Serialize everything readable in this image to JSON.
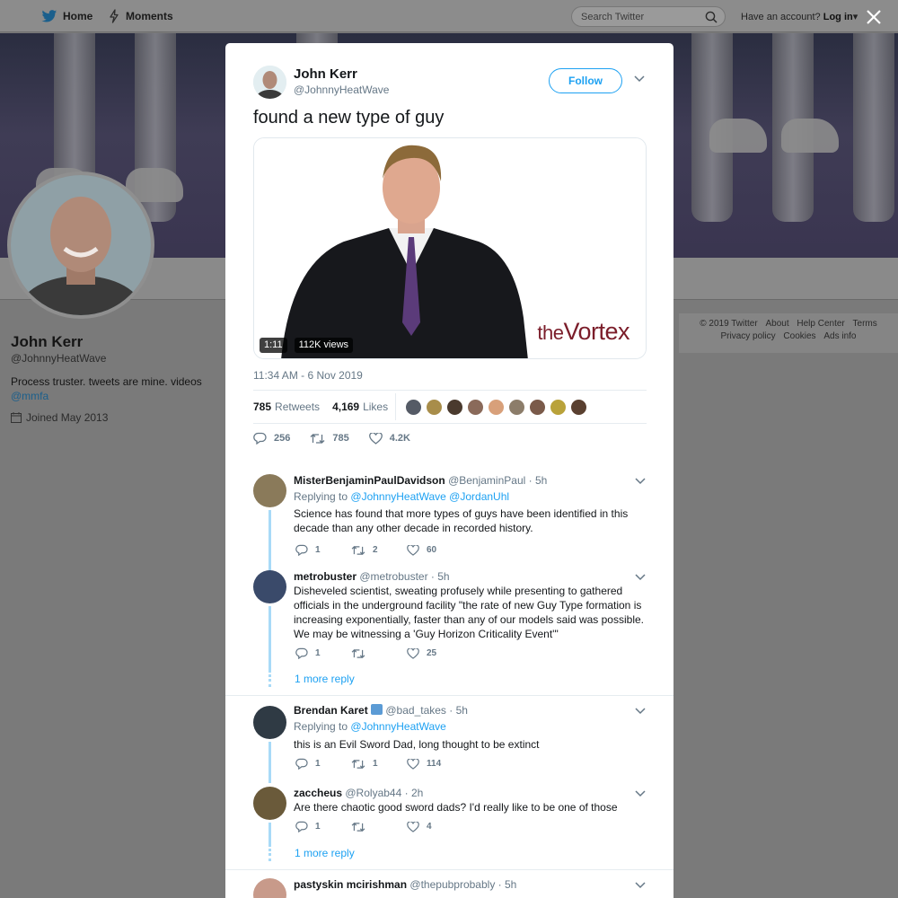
{
  "nav": {
    "home_label": "Home",
    "moments_label": "Moments",
    "search_placeholder": "Search Twitter",
    "have_account": "Have an account?",
    "login_label": "Log in"
  },
  "profile": {
    "name": "John Kerr",
    "handle": "@JohnnyHeatWave",
    "bio": "Process truster. tweets are mine. videos",
    "bio_link": "@mmfa",
    "joined": "Joined May 2013"
  },
  "footer": {
    "items": [
      "© 2019 Twitter",
      "About",
      "Help Center",
      "Terms",
      "Privacy policy",
      "Cookies",
      "Ads info"
    ]
  },
  "tweet": {
    "author_name": "John Kerr",
    "author_handle": "@JohnnyHeatWave",
    "follow_label": "Follow",
    "text": "found a new type of guy",
    "video_duration": "1:11",
    "video_views": "112K views",
    "video_brand_prefix": "the",
    "video_brand_name": "Vortex",
    "timestamp": "11:34 AM - 6 Nov 2019",
    "retweets_count": "785",
    "retweets_label": "Retweets",
    "likes_count": "4,169",
    "likes_label": "Likes",
    "action_replies": "256",
    "action_retweets": "785",
    "action_likes": "4.2K",
    "liker_colors": [
      "#555b66",
      "#a88d4a",
      "#4a3a2e",
      "#8a6a5a",
      "#d8a07a",
      "#8c7d6a",
      "#7a5a4a",
      "#b9a23a",
      "#5a4030"
    ]
  },
  "replies": [
    {
      "name": "MisterBenjaminPaulDavidson",
      "handle": "@BenjaminPaul",
      "time": "· 5h",
      "replying_prefix": "Replying to",
      "replying_to": "@JohnnyHeatWave @JordanUhl",
      "text": "Science has found that more types of guys have been identified in this decade than any other decade in recorded history.",
      "replies": "1",
      "retweets": "2",
      "likes": "60"
    },
    {
      "name": "metrobuster",
      "handle": "@metrobuster",
      "time": "· 5h",
      "text": "Disheveled scientist, sweating profusely while presenting to gathered officials in the underground facility \"the rate of new Guy Type formation is increasing exponentially, faster than any of our models said was possible. We may be witnessing a 'Guy Horizon Criticality Event'\"",
      "replies": "1",
      "retweets": "",
      "likes": "25",
      "more_reply": "1 more reply"
    },
    {
      "name": "Brendan Karet",
      "handle": "@bad_takes",
      "time": "· 5h",
      "replying_prefix": "Replying to",
      "replying_to": "@JohnnyHeatWave",
      "text": "this is an Evil Sword Dad, long thought to be extinct",
      "replies": "1",
      "retweets": "1",
      "likes": "114"
    },
    {
      "name": "zaccheus",
      "handle": "@Rolyab44",
      "time": "· 2h",
      "text": "Are there chaotic good sword dads?  I'd really like to be one of those",
      "replies": "1",
      "retweets": "",
      "likes": "4",
      "more_reply": "1 more reply"
    },
    {
      "name": "pastyskin mcirishman",
      "handle": "@thepubprobably",
      "time": "· 5h"
    }
  ]
}
